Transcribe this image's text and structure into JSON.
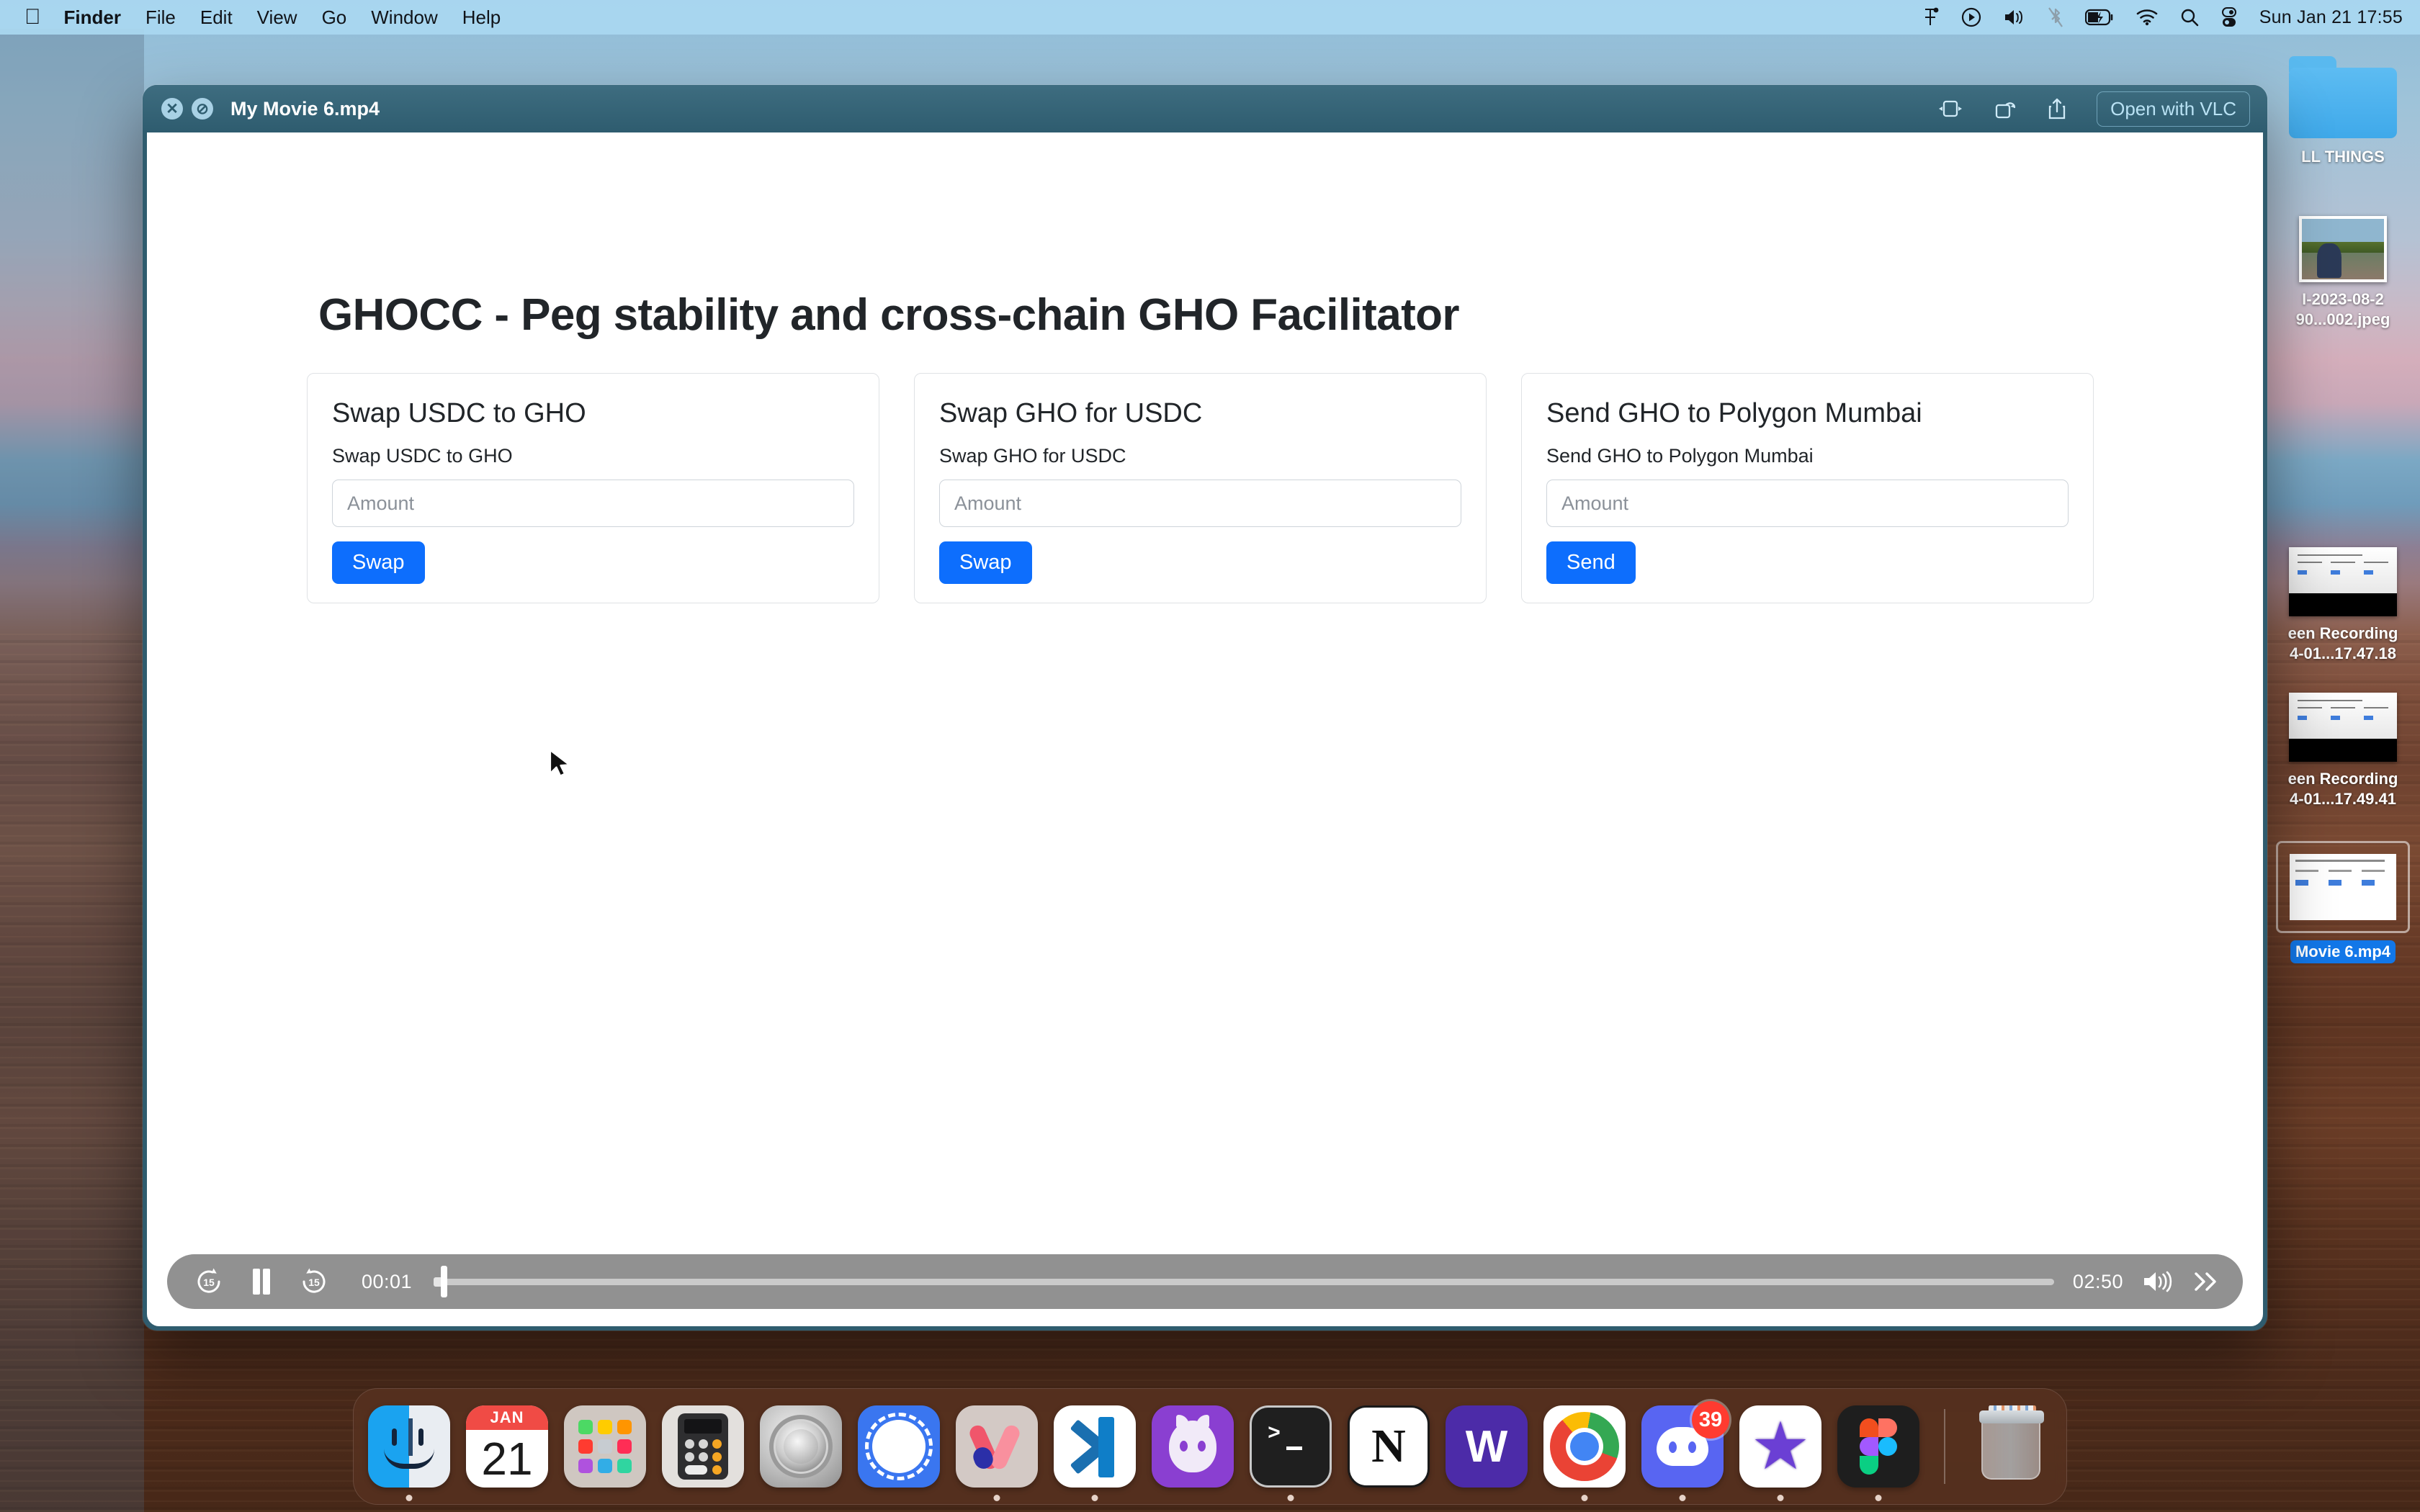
{
  "menubar": {
    "apple": "",
    "items": [
      {
        "label": "Finder",
        "bold": true
      },
      {
        "label": "File",
        "bold": false
      },
      {
        "label": "Edit",
        "bold": false
      },
      {
        "label": "View",
        "bold": false
      },
      {
        "label": "Go",
        "bold": false
      },
      {
        "label": "Window",
        "bold": false
      },
      {
        "label": "Help",
        "bold": false
      }
    ],
    "status_icons": [
      "figma-menu-icon",
      "screen-recording-icon",
      "volume-icon",
      "bluetooth-off-icon",
      "battery-charging-icon",
      "wifi-icon",
      "spotlight-search-icon",
      "control-center-icon"
    ],
    "clock": "Sun Jan 21  17:55"
  },
  "desktop": {
    "icons": [
      {
        "name": "folder",
        "label_line1": "LL THINGS",
        "label_line2": "",
        "selected": false
      },
      {
        "name": "photo",
        "label_line1": "I-2023-08-2",
        "label_line2": "90...002.jpeg",
        "selected": false
      },
      {
        "name": "screen-recording-1",
        "label_line1": "een Recording",
        "label_line2": "4-01...17.47.18",
        "selected": false
      },
      {
        "name": "screen-recording-2",
        "label_line1": "een Recording",
        "label_line2": "4-01...17.49.41",
        "selected": false
      },
      {
        "name": "movie-file",
        "label_line1": "Movie 6.mp4",
        "label_line2": "",
        "selected": true
      }
    ]
  },
  "quicklook": {
    "title": "My Movie 6.mp4",
    "close_label": "✕",
    "minimize_label": "⊘",
    "toolbar_icons": [
      "trim-icon",
      "rotate-icon",
      "share-icon"
    ],
    "open_with_label": "Open with VLC"
  },
  "webpage": {
    "title": "GHOCC - Peg stability and cross-chain GHO Facilitator",
    "cards": [
      {
        "name": "swap-usdc-to-gho",
        "title": "Swap USDC to GHO",
        "subtitle": "Swap USDC to GHO",
        "input_value": "",
        "input_placeholder": "Amount",
        "button_label": "Swap"
      },
      {
        "name": "swap-gho-for-usdc",
        "title": "Swap GHO for USDC",
        "subtitle": "Swap GHO for USDC",
        "input_value": "",
        "input_placeholder": "Amount",
        "button_label": "Swap"
      },
      {
        "name": "send-gho-to-polygon-mumbai",
        "title": "Send GHO to Polygon Mumbai",
        "subtitle": "Send GHO to Polygon Mumbai",
        "input_value": "",
        "input_placeholder": "Amount",
        "button_label": "Send"
      }
    ],
    "accent_color": "#0d6efd"
  },
  "player": {
    "rewind_label": "15",
    "forward_label": "15",
    "playpause_state": "pause",
    "current_time": "00:01",
    "duration": "02:50",
    "progress_percent": 0,
    "volume_icon": "volume-high-icon",
    "next_icon": "fast-forward-icon"
  },
  "dock": {
    "items": [
      {
        "name": "finder",
        "label": "Finder",
        "running": true,
        "badge": ""
      },
      {
        "name": "calendar",
        "label": "Calendar",
        "month": "JAN",
        "day": "21",
        "running": false,
        "badge": ""
      },
      {
        "name": "launchpad",
        "label": "Launchpad",
        "running": false,
        "badge": ""
      },
      {
        "name": "calculator",
        "label": "Calculator",
        "running": false,
        "badge": ""
      },
      {
        "name": "system-settings",
        "label": "System Settings",
        "running": false,
        "badge": ""
      },
      {
        "name": "signal",
        "label": "Signal",
        "running": false,
        "badge": ""
      },
      {
        "name": "arc",
        "label": "Arc",
        "running": true,
        "badge": ""
      },
      {
        "name": "vscode",
        "label": "Visual Studio Code",
        "running": true,
        "badge": ""
      },
      {
        "name": "github-desktop",
        "label": "GitHub Desktop",
        "running": false,
        "badge": ""
      },
      {
        "name": "terminal",
        "label": "Terminal",
        "running": true,
        "badge": ""
      },
      {
        "name": "notion",
        "label": "Notion",
        "running": false,
        "badge": ""
      },
      {
        "name": "warp",
        "label": "W",
        "running": false,
        "badge": ""
      },
      {
        "name": "chrome",
        "label": "Google Chrome",
        "running": true,
        "badge": ""
      },
      {
        "name": "discord",
        "label": "Discord",
        "running": true,
        "badge": "39"
      },
      {
        "name": "imovie",
        "label": "iMovie",
        "running": true,
        "badge": ""
      },
      {
        "name": "figma",
        "label": "Figma",
        "running": true,
        "badge": ""
      },
      {
        "name": "trash",
        "label": "Trash",
        "running": false,
        "badge": ""
      }
    ]
  }
}
